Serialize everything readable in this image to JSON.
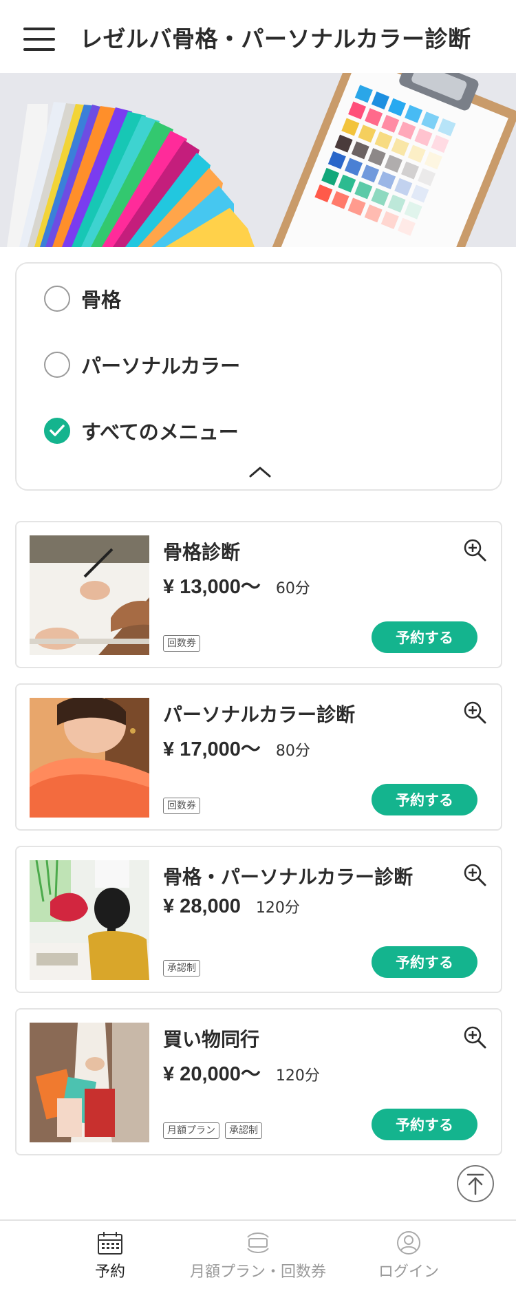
{
  "header": {
    "title": "レゼルバ骨格・パーソナルカラー診断",
    "menu_icon": "hamburger-icon"
  },
  "filters": {
    "options": [
      {
        "label": "骨格",
        "checked": false
      },
      {
        "label": "パーソナルカラー",
        "checked": false
      },
      {
        "label": "すべてのメニュー",
        "checked": true
      }
    ],
    "collapse_icon": "chevron-up-icon"
  },
  "menu_items": [
    {
      "title": "骨格診断",
      "price": "¥ 13,000〜",
      "duration": "60分",
      "tags": [
        "回数券"
      ],
      "button": "予約する"
    },
    {
      "title": "パーソナルカラー診断",
      "price": "¥ 17,000〜",
      "duration": "80分",
      "tags": [
        "回数券"
      ],
      "button": "予約する"
    },
    {
      "title": "骨格・パーソナルカラー診断",
      "price": "¥ 28,000",
      "duration": "120分",
      "tags": [
        "承認制"
      ],
      "button": "予約する"
    },
    {
      "title": "買い物同行",
      "price": "¥ 20,000〜",
      "duration": "120分",
      "tags": [
        "月額プラン",
        "承認制"
      ],
      "button": "予約する"
    }
  ],
  "bottom_nav": {
    "items": [
      {
        "label": "予約",
        "icon": "calendar-icon",
        "active": true
      },
      {
        "label": "月額プラン・回数券",
        "icon": "ticket-icon",
        "active": false
      },
      {
        "label": "ログイン",
        "icon": "user-icon",
        "active": false
      }
    ]
  },
  "colors": {
    "accent": "#14b48e",
    "text": "#2b2b2b",
    "border": "#e4e4e4"
  }
}
